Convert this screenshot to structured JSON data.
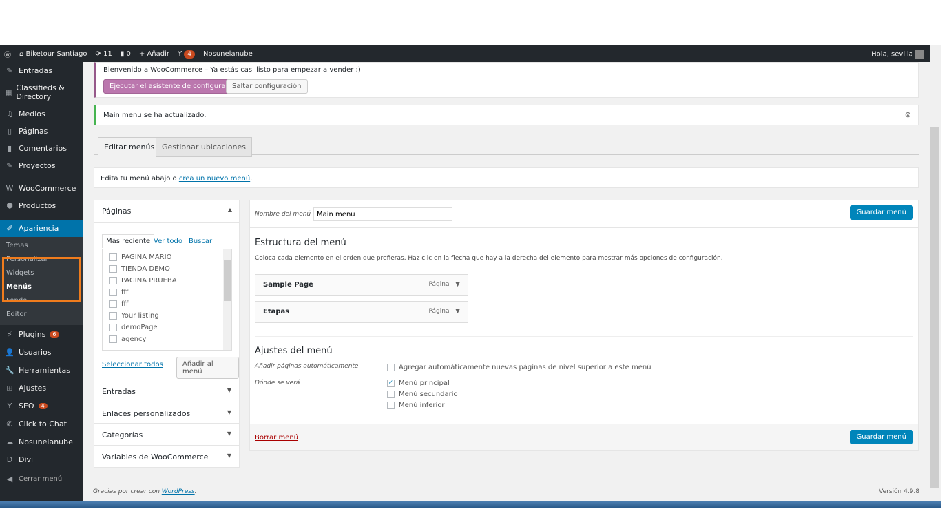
{
  "adminbar": {
    "site": "Biketour Santiago",
    "updates": "11",
    "comments": "0",
    "add": "Añadir",
    "yoast_count": "4",
    "user_site": "Nosunelanube",
    "greeting": "Hola, sevilla"
  },
  "sidebar": {
    "items": [
      {
        "label": "Entradas",
        "icon": "pin"
      },
      {
        "label": "Classifieds & Directory",
        "icon": "grid"
      },
      {
        "label": "Medios",
        "icon": "media"
      },
      {
        "label": "Páginas",
        "icon": "page"
      },
      {
        "label": "Comentarios",
        "icon": "comment"
      },
      {
        "label": "Proyectos",
        "icon": "pin"
      },
      {
        "label": "WooCommerce",
        "icon": "woo"
      },
      {
        "label": "Productos",
        "icon": "box"
      },
      {
        "label": "Apariencia",
        "icon": "brush"
      }
    ],
    "submenu": [
      "Temas",
      "Personalizar",
      "Widgets",
      "Menús",
      "Fondo",
      "Editor"
    ],
    "items2": [
      {
        "label": "Plugins",
        "badge": "6"
      },
      {
        "label": "Usuarios"
      },
      {
        "label": "Herramientas"
      },
      {
        "label": "Ajustes"
      },
      {
        "label": "SEO",
        "badge": "4"
      },
      {
        "label": "Click to Chat"
      },
      {
        "label": "Nosunelanube"
      },
      {
        "label": "Divi"
      },
      {
        "label": "Cerrar menú"
      }
    ]
  },
  "notice_woo": {
    "text": "Bienvenido a WooCommerce – Ya estás casi listo para empezar a vender :)",
    "run": "Ejecutar el asistente de configuración",
    "skip": "Saltar configuración"
  },
  "notice_updated": "Main menu se ha actualizado.",
  "tabs": [
    "Editar menús",
    "Gestionar ubicaciones"
  ],
  "edit_hint": {
    "pre": "Edita tu menú abajo o ",
    "link": "crea un nuevo menú",
    "post": "."
  },
  "pages_box": {
    "title": "Páginas",
    "tabs": [
      "Más reciente",
      "Ver todo",
      "Buscar"
    ],
    "pages": [
      "PAGINA MARIO",
      "TIENDA DEMO",
      "PAGINA PRUEBA",
      "fff",
      "fff",
      "Your listing",
      "demoPage",
      "agency"
    ],
    "select_all": "Seleccionar todos",
    "add": "Añadir al menú"
  },
  "accordions": [
    "Entradas",
    "Enlaces personalizados",
    "Categorías",
    "Variables de WooCommerce"
  ],
  "menu": {
    "name_label": "Nombre del menú",
    "name_value": "Main menu",
    "save": "Guardar menú",
    "structure_title": "Estructura del menú",
    "structure_hint": "Coloca cada elemento en el orden que prefieras. Haz clic en la flecha que hay a la derecha del elemento para mostrar más opciones de configuración.",
    "items": [
      {
        "title": "Sample Page",
        "type": "Página"
      },
      {
        "title": "Etapas",
        "type": "Página"
      }
    ],
    "settings_title": "Ajustes del menú",
    "auto_label": "Añadir páginas automáticamente",
    "auto_text": "Agregar automáticamente nuevas páginas de nivel superior a este menú",
    "where_label": "Dónde se verá",
    "locations": [
      {
        "label": "Menú principal",
        "checked": true
      },
      {
        "label": "Menú secundario",
        "checked": false
      },
      {
        "label": "Menú inferior",
        "checked": false
      }
    ],
    "delete": "Borrar menú"
  },
  "footer": {
    "thanks": "Gracias por crear con ",
    "link": "WordPress",
    "version": "Versión 4.9.8"
  }
}
